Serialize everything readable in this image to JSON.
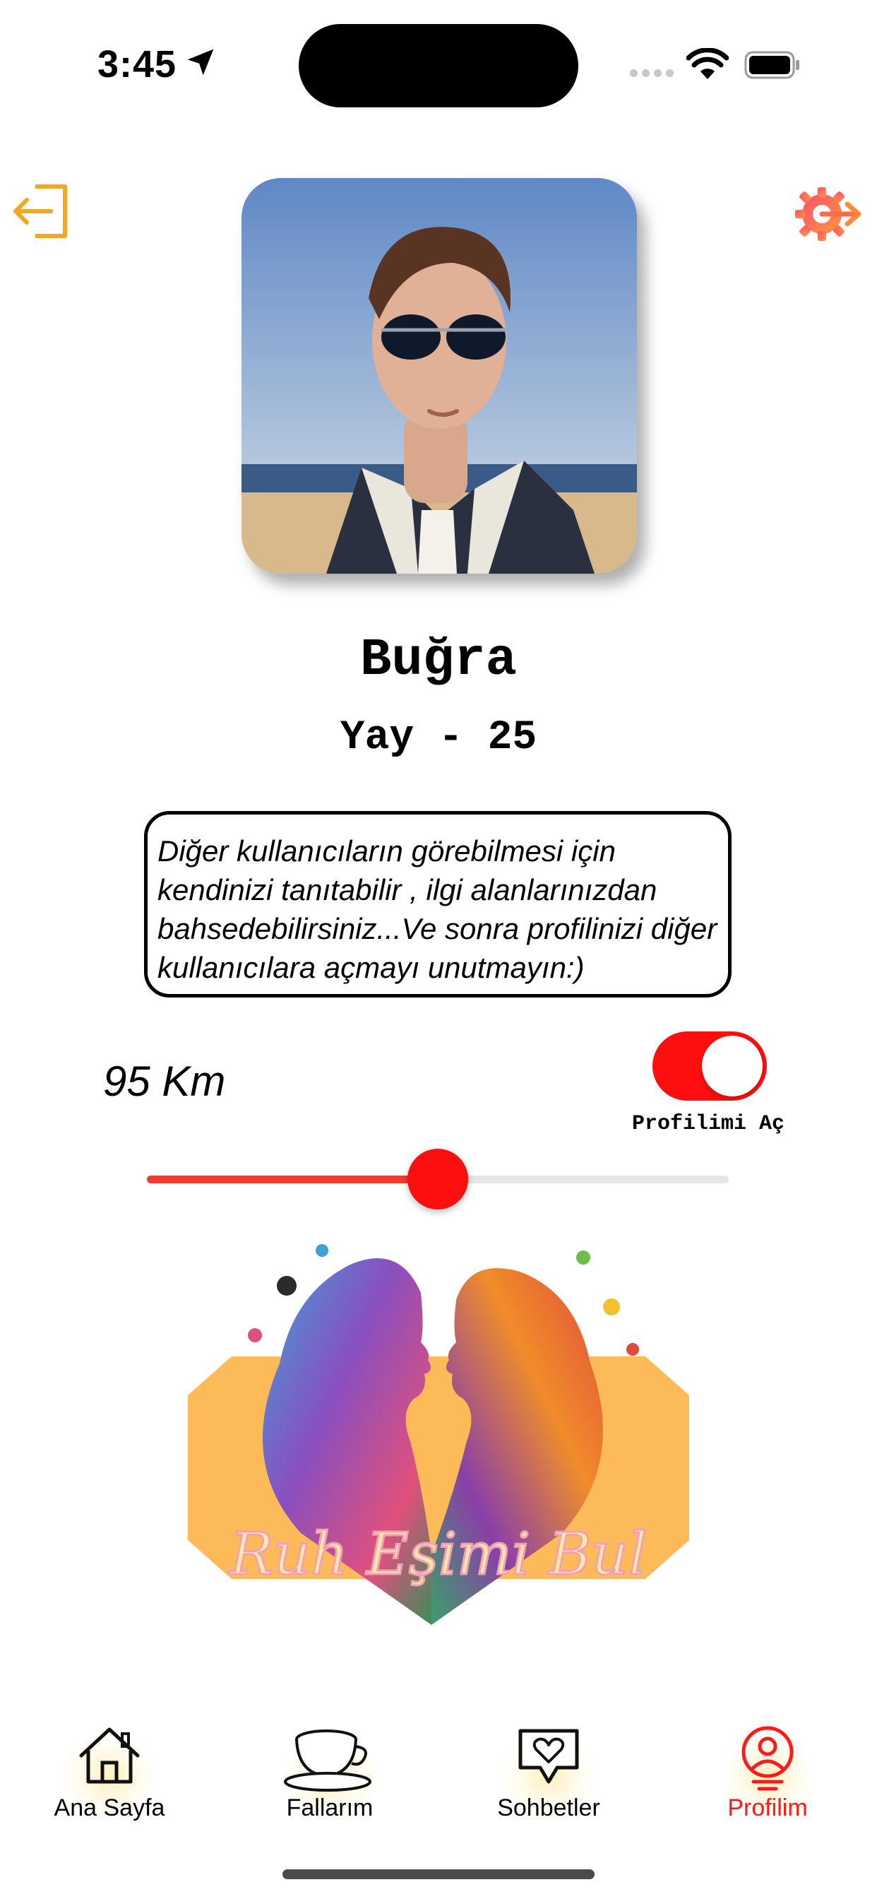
{
  "status_bar": {
    "time": "3:45",
    "icons": [
      "location-arrow-icon",
      "cellular-signal-icon",
      "wifi-icon",
      "battery-icon"
    ]
  },
  "header": {
    "left_icon": "logout-icon",
    "right_icon": "settings-gear-icon"
  },
  "profile": {
    "name": "Buğra",
    "sign_age": "Yay - 25",
    "bio": "Diğer kullanıcıların görebilmesi için kendinizi tanıtabilir , ilgi alanlarınızdan bahsedebilirsiniz...Ve sonra profilinizi diğer kullanıcılara açmayı unutmayın:)",
    "distance_label": "95 Km",
    "distance_slider_fraction": 0.5
  },
  "visibility_toggle": {
    "label": "Profilimi Aç",
    "on": true
  },
  "banner": {
    "text": "Ruh Eşimi Bul"
  },
  "tabbar": {
    "tabs": [
      {
        "label": "Ana Sayfa",
        "icon": "house-icon",
        "active": false
      },
      {
        "label": "Fallarım",
        "icon": "coffee-cup-icon",
        "active": false
      },
      {
        "label": "Sohbetler",
        "icon": "heart-chat-icon",
        "active": false
      },
      {
        "label": "Profilim",
        "icon": "user-profile-icon",
        "active": true
      }
    ]
  },
  "colors": {
    "accent_red": "#fe0f0f",
    "banner_orange": "#fcbb58",
    "logout_orange": "#f5a623"
  }
}
